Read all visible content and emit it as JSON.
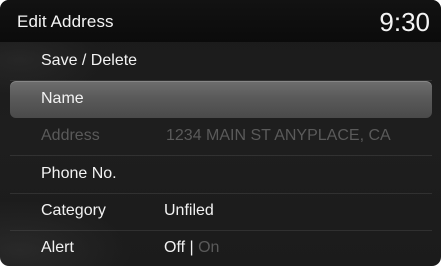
{
  "header": {
    "title": "Edit Address",
    "time": "9:30"
  },
  "menu": {
    "save_delete": {
      "label": "Save / Delete"
    },
    "name": {
      "label": "Name",
      "selected": true
    },
    "address": {
      "label": "Address",
      "value": "1234 MAIN ST ANYPLACE, CA",
      "enabled": false
    },
    "phone": {
      "label": "Phone No."
    },
    "category": {
      "label": "Category",
      "value": "Unfiled"
    },
    "alert": {
      "label": "Alert",
      "option_off": "Off",
      "separator": "|",
      "option_on": "On",
      "selected_option": "Off"
    }
  }
}
